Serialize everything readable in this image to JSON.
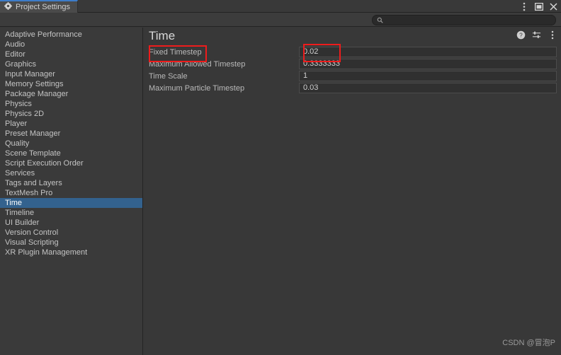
{
  "window": {
    "tab_label": "Project Settings",
    "tab_icon": "gear-icon",
    "buttons": [
      {
        "name": "kebab-menu-icon",
        "label": "⋮"
      },
      {
        "name": "maximize-icon",
        "label": "❐"
      },
      {
        "name": "close-icon",
        "label": "✕"
      }
    ]
  },
  "search": {
    "placeholder": "",
    "value": "",
    "icon": "search-icon"
  },
  "sidebar": {
    "items": [
      {
        "label": "Adaptive Performance",
        "selected": false
      },
      {
        "label": "Audio",
        "selected": false
      },
      {
        "label": "Editor",
        "selected": false
      },
      {
        "label": "Graphics",
        "selected": false
      },
      {
        "label": "Input Manager",
        "selected": false
      },
      {
        "label": "Memory Settings",
        "selected": false
      },
      {
        "label": "Package Manager",
        "selected": false
      },
      {
        "label": "Physics",
        "selected": false
      },
      {
        "label": "Physics 2D",
        "selected": false
      },
      {
        "label": "Player",
        "selected": false
      },
      {
        "label": "Preset Manager",
        "selected": false
      },
      {
        "label": "Quality",
        "selected": false
      },
      {
        "label": "Scene Template",
        "selected": false
      },
      {
        "label": "Script Execution Order",
        "selected": false
      },
      {
        "label": "Services",
        "selected": false
      },
      {
        "label": "Tags and Layers",
        "selected": false
      },
      {
        "label": "TextMesh Pro",
        "selected": false
      },
      {
        "label": "Time",
        "selected": true
      },
      {
        "label": "Timeline",
        "selected": false
      },
      {
        "label": "UI Builder",
        "selected": false
      },
      {
        "label": "Version Control",
        "selected": false
      },
      {
        "label": "Visual Scripting",
        "selected": false
      },
      {
        "label": "XR Plugin Management",
        "selected": false
      }
    ]
  },
  "panel": {
    "title": "Time",
    "header_icons": [
      {
        "name": "help-icon",
        "label": "?"
      },
      {
        "name": "preset-icon",
        "label": "preset"
      },
      {
        "name": "kebab-menu-icon",
        "label": "⋮"
      }
    ],
    "rows": [
      {
        "label": "Fixed Timestep",
        "value": "0.02"
      },
      {
        "label": "Maximum Allowed Timestep",
        "value": "0.3333333"
      },
      {
        "label": "Time Scale",
        "value": "1"
      },
      {
        "label": "Maximum Particle Timestep",
        "value": "0.03"
      }
    ]
  },
  "annotations": {
    "color": "#ee1c1c",
    "boxes": [
      {
        "name": "fixed-timestep-label-highlight"
      },
      {
        "name": "fixed-timestep-value-highlight"
      }
    ]
  },
  "watermark": {
    "text": "CSDN @冒泡P"
  }
}
